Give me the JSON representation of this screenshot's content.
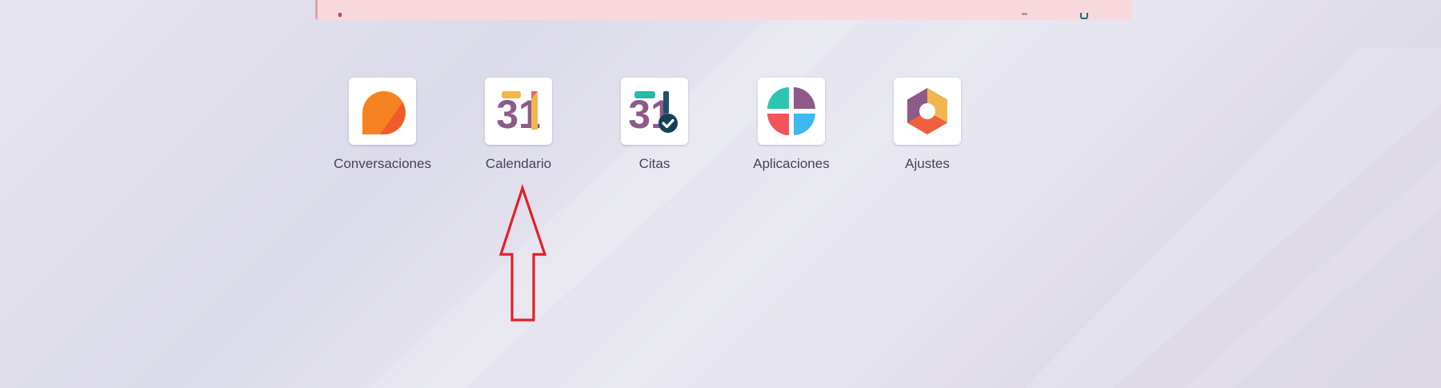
{
  "apps": [
    {
      "label": "Conversaciones",
      "icon": "chat-bubble-icon"
    },
    {
      "label": "Calendario",
      "icon": "calendar-31-icon"
    },
    {
      "label": "Citas",
      "icon": "appointments-31-check-icon"
    },
    {
      "label": "Aplicaciones",
      "icon": "apps-quadrants-icon"
    },
    {
      "label": "Ajustes",
      "icon": "settings-hexagon-icon"
    }
  ],
  "icons": {
    "conversaciones": {
      "digits": ""
    },
    "calendario": {
      "digits": "31"
    },
    "citas": {
      "digits": "31"
    }
  },
  "colors": {
    "annotation_arrow": "#e0202a",
    "alert_background": "#f7d9dd",
    "label_text": "#4a4458"
  }
}
